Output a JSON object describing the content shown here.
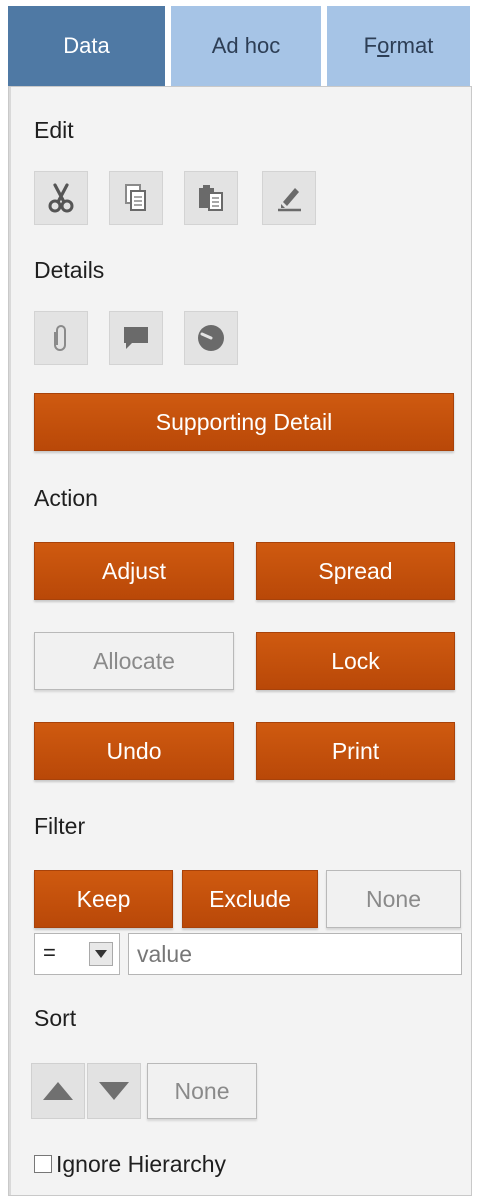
{
  "tabs": [
    {
      "label": "Data",
      "active": true
    },
    {
      "label": "Ad hoc",
      "active": false
    },
    {
      "label_prefix": "F",
      "label_underlined": "o",
      "label_suffix": "rmat",
      "active": false
    }
  ],
  "edit": {
    "label": "Edit",
    "icons": [
      "cut-icon",
      "copy-icon",
      "paste-icon",
      "clear-icon"
    ]
  },
  "details": {
    "label": "Details",
    "icons": [
      "attachment-icon",
      "comment-icon",
      "history-icon"
    ],
    "supporting_detail_label": "Supporting Detail"
  },
  "action": {
    "label": "Action",
    "adjust": "Adjust",
    "spread": "Spread",
    "allocate": "Allocate",
    "lock": "Lock",
    "undo": "Undo",
    "print": "Print"
  },
  "filter": {
    "label": "Filter",
    "keep": "Keep",
    "exclude": "Exclude",
    "none": "None",
    "operator": "=",
    "value_placeholder": "value"
  },
  "sort": {
    "label": "Sort",
    "none": "None"
  },
  "ignore_hierarchy": {
    "label": "Ignore Hierarchy",
    "checked": false
  },
  "colors": {
    "tab_active": "#4f79a4",
    "tab_inactive": "#a6c4e6",
    "accent_orange": "#c2500c",
    "panel_bg": "#f3f3f3"
  }
}
